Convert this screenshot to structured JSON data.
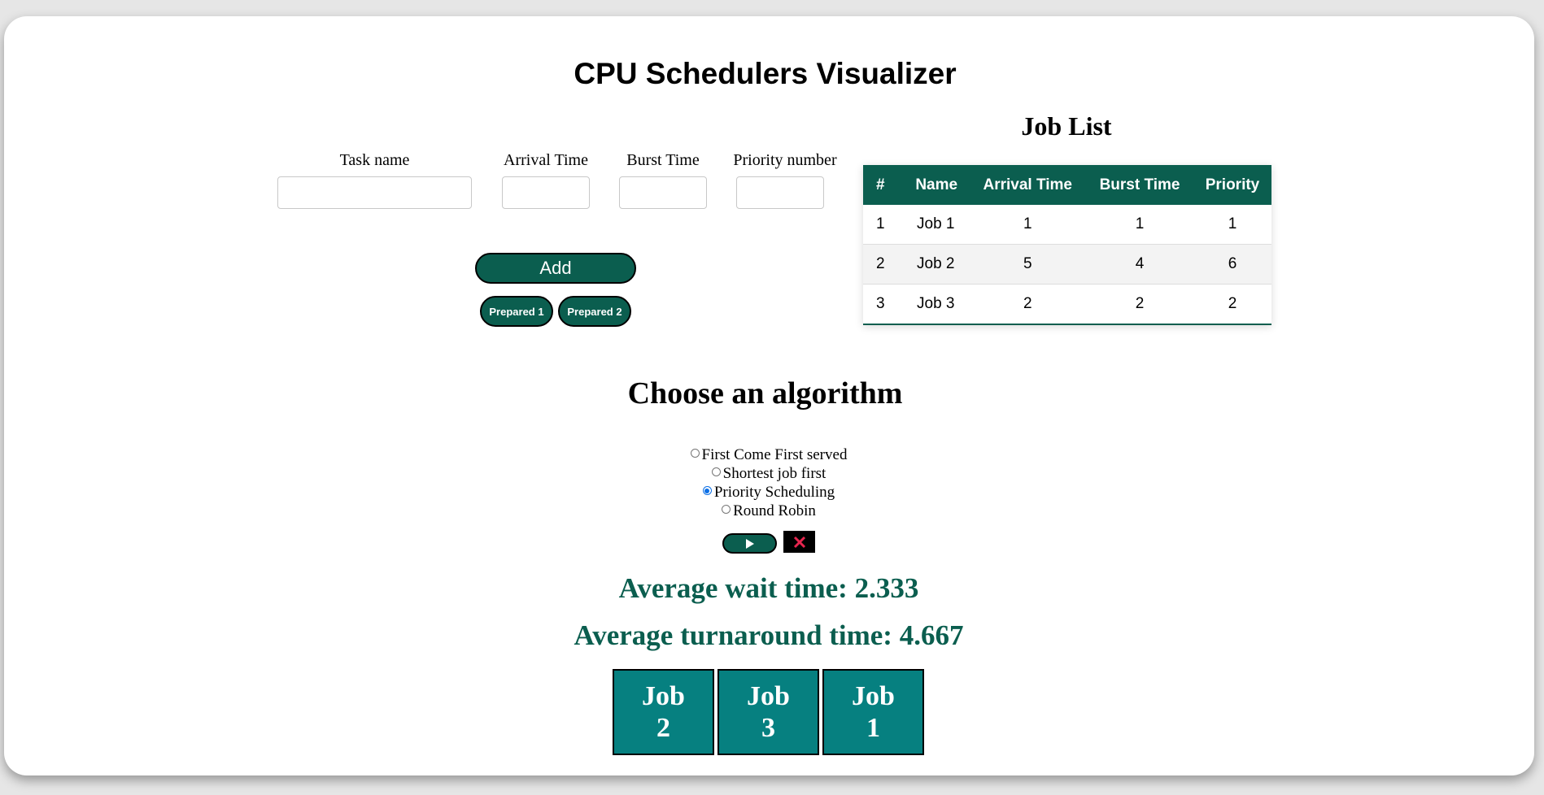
{
  "page": {
    "title": "CPU Schedulers Visualizer"
  },
  "form": {
    "task_name_label": "Task name",
    "arrival_time_label": "Arrival Time",
    "burst_time_label": "Burst Time",
    "priority_label": "Priority number",
    "task_name_value": "",
    "arrival_time_value": "",
    "burst_time_value": "",
    "priority_value": "",
    "add_label": "Add",
    "prepared_1_label": "Prepared 1",
    "prepared_2_label": "Prepared 2"
  },
  "job_list": {
    "title": "Job List",
    "headers": [
      "#",
      "Name",
      "Arrival Time",
      "Burst Time",
      "Priority"
    ],
    "rows": [
      {
        "num": "1",
        "name": "Job 1",
        "arrival": "1",
        "burst": "1",
        "priority": "1"
      },
      {
        "num": "2",
        "name": "Job 2",
        "arrival": "5",
        "burst": "4",
        "priority": "6"
      },
      {
        "num": "3",
        "name": "Job 3",
        "arrival": "2",
        "burst": "2",
        "priority": "2"
      }
    ]
  },
  "algorithm": {
    "title": "Choose an algorithm",
    "options": [
      {
        "label": "First Come First served",
        "selected": false
      },
      {
        "label": "Shortest job first",
        "selected": false
      },
      {
        "label": "Priority Scheduling",
        "selected": true
      },
      {
        "label": "Round Robin",
        "selected": false
      }
    ],
    "play_icon": "play-icon",
    "stop_icon": "close-icon"
  },
  "results": {
    "avg_wait_text": "Average wait time: 2.333",
    "avg_turnaround_text": "Average turnaround time: 4.667",
    "gantt": [
      {
        "line1": "Job",
        "line2": "2"
      },
      {
        "line1": "Job",
        "line2": "3"
      },
      {
        "line1": "Job",
        "line2": "1"
      }
    ]
  },
  "colors": {
    "accent": "#0b5e4f",
    "gantt_fill": "#068080",
    "stop_icon": "#e8264f"
  }
}
